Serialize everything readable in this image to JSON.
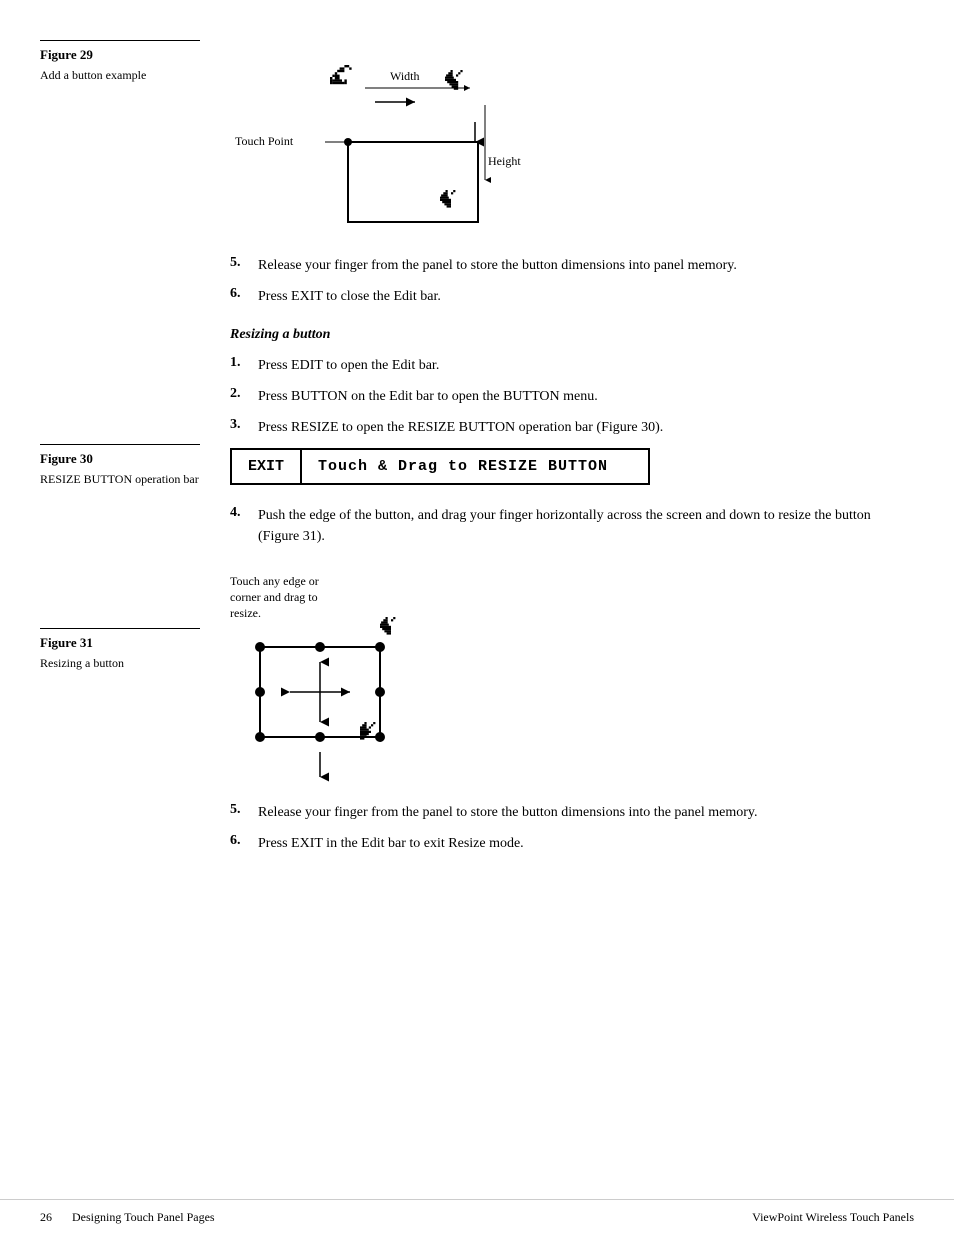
{
  "page": {
    "footer": {
      "page_number": "26",
      "left_text": "Designing Touch Panel Pages",
      "right_text": "ViewPoint Wireless Touch Panels"
    }
  },
  "figure29": {
    "label": "Figure 29",
    "description": "Add a button example",
    "width_label": "Width",
    "height_label": "Height",
    "touch_point_label": "Touch Point"
  },
  "steps_before_resize": [
    {
      "num": "5.",
      "text": "Release your finger from the panel to store the button dimensions into panel memory."
    },
    {
      "num": "6.",
      "text": "Press EXIT to close the Edit bar."
    }
  ],
  "resizing_section": {
    "title": "Resizing a button",
    "steps": [
      {
        "num": "1.",
        "text": "Press EDIT to open the Edit bar."
      },
      {
        "num": "2.",
        "text": "Press BUTTON on the Edit bar to open the BUTTON menu."
      },
      {
        "num": "3.",
        "text": "Press RESIZE to open the RESIZE BUTTON operation bar (Figure 30)."
      }
    ]
  },
  "figure30": {
    "label": "Figure 30",
    "description": "RESIZE BUTTON operation bar",
    "exit_label": "EXIT",
    "bar_text": "Touch & Drag to RESIZE BUTTON"
  },
  "steps_after_figure30": [
    {
      "num": "4.",
      "text": "Push the edge of the button, and drag your finger horizontally across the screen and down to resize the button (Figure 31)."
    }
  ],
  "figure31": {
    "label": "Figure 31",
    "description": "Resizing a button",
    "touch_text": "Touch any edge or corner and drag to resize."
  },
  "steps_after_figure31": [
    {
      "num": "5.",
      "text": "Release your finger from the panel to store the button dimensions into the panel memory."
    },
    {
      "num": "6.",
      "text": "Press EXIT in the Edit bar to exit Resize mode."
    }
  ]
}
